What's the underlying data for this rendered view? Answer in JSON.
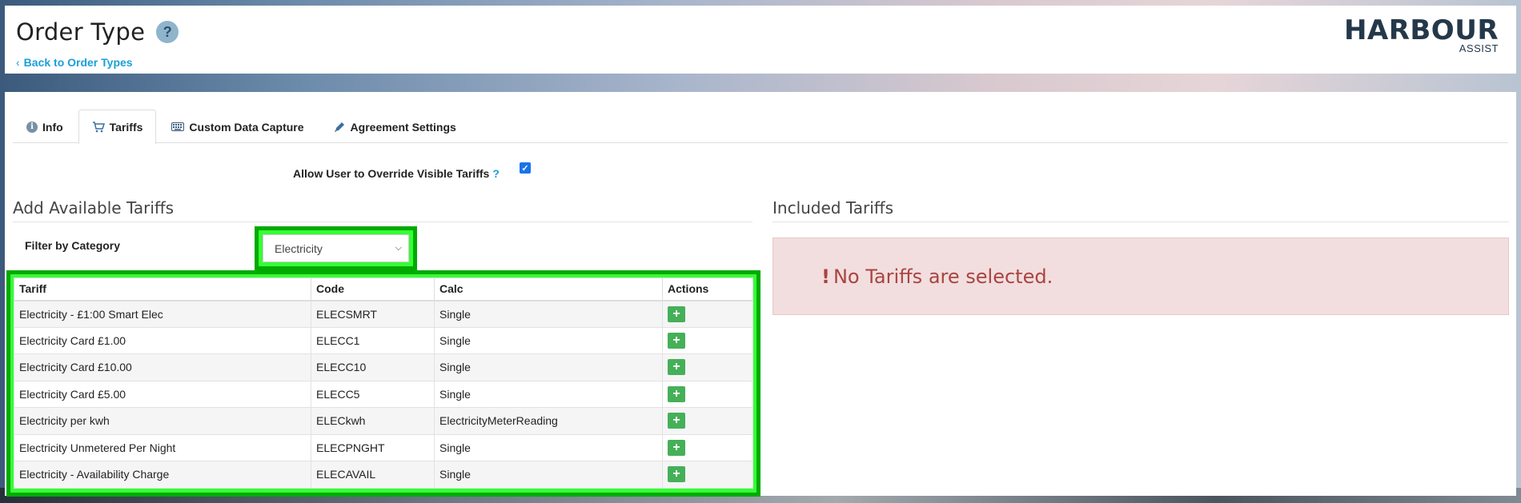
{
  "header": {
    "title": "Order Type",
    "help_icon": "question-icon",
    "back_link": "Back to Order Types",
    "logo_main": "HARBOUR",
    "logo_sub": "ASSIST"
  },
  "tabs": [
    {
      "label": "Info",
      "icon": "info-icon"
    },
    {
      "label": "Tariffs",
      "icon": "cart-icon",
      "active": true
    },
    {
      "label": "Custom Data Capture",
      "icon": "keyboard-icon"
    },
    {
      "label": "Agreement Settings",
      "icon": "pen-icon"
    }
  ],
  "override": {
    "label": "Allow User to Override Visible Tariffs",
    "help": "?",
    "checked": true
  },
  "available": {
    "title": "Add Available Tariffs",
    "filter_label": "Filter by Category",
    "filter_value": "Electricity",
    "columns": [
      "Tariff",
      "Code",
      "Calc",
      "Actions"
    ],
    "rows": [
      {
        "tariff": "Electricity - £1:00 Smart Elec",
        "code": "ELECSMRT",
        "calc": "Single"
      },
      {
        "tariff": "Electricity Card £1.00",
        "code": "ELECC1",
        "calc": "Single"
      },
      {
        "tariff": "Electricity Card £10.00",
        "code": "ELECC10",
        "calc": "Single"
      },
      {
        "tariff": "Electricity Card £5.00",
        "code": "ELECC5",
        "calc": "Single"
      },
      {
        "tariff": "Electricity per kwh",
        "code": "ELECkwh",
        "calc": "ElectricityMeterReading"
      },
      {
        "tariff": "Electricity Unmetered Per Night",
        "code": "ELECPNGHT",
        "calc": "Single"
      },
      {
        "tariff": "Electricity - Availability Charge",
        "code": "ELECAVAIL",
        "calc": "Single"
      }
    ],
    "add_label": "+"
  },
  "included": {
    "title": "Included Tariffs",
    "empty_message": "No Tariffs are selected.",
    "empty_bang": "!"
  },
  "colors": {
    "accent": "#1a9fd9",
    "highlight": "#35ff35",
    "add_button": "#45b058",
    "alert_bg": "#f2dede",
    "alert_text": "#a94442"
  }
}
